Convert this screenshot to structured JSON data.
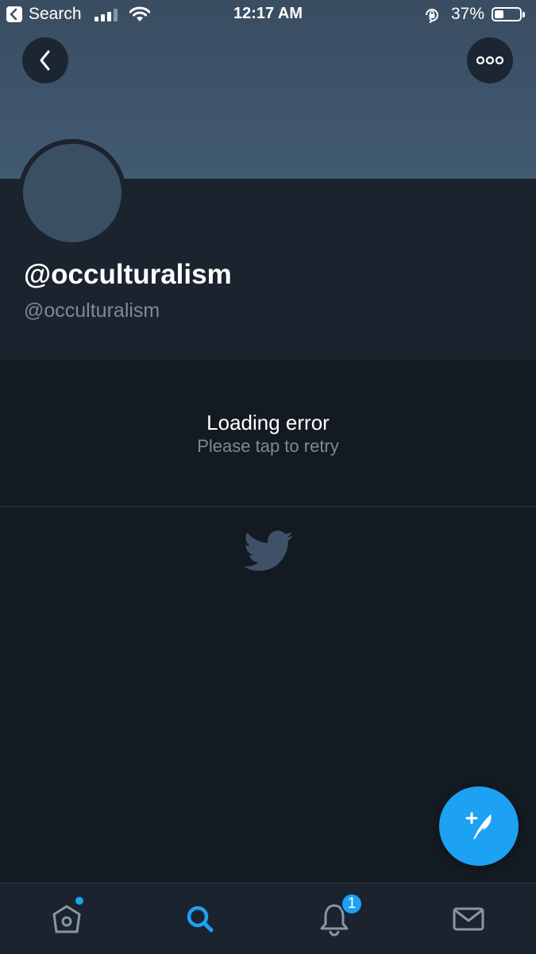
{
  "status_bar": {
    "back_app_label": "Search",
    "time": "12:17 AM",
    "battery_percent": "37%",
    "signal_bars_filled": 3,
    "signal_bars_total": 4,
    "battery_level": 0.37
  },
  "header": {
    "back_icon": "chevron-left-icon",
    "more_icon": "more-horizontal-icon"
  },
  "profile": {
    "display_name": "@occulturalism",
    "handle": "@occulturalism"
  },
  "error": {
    "title": "Loading error",
    "subtitle": "Please tap to retry"
  },
  "compose_button": {
    "icon": "compose-tweet-icon"
  },
  "tab_bar": {
    "items": [
      {
        "icon": "home-icon",
        "has_dot": true
      },
      {
        "icon": "search-icon",
        "active": true
      },
      {
        "icon": "notifications-icon",
        "badge": "1"
      },
      {
        "icon": "messages-icon"
      }
    ]
  },
  "colors": {
    "accent": "#1da1f2",
    "background": "#141a22",
    "banner": "#415a72",
    "profile_background": "#1a232e",
    "muted_text": "#7b8a99"
  }
}
